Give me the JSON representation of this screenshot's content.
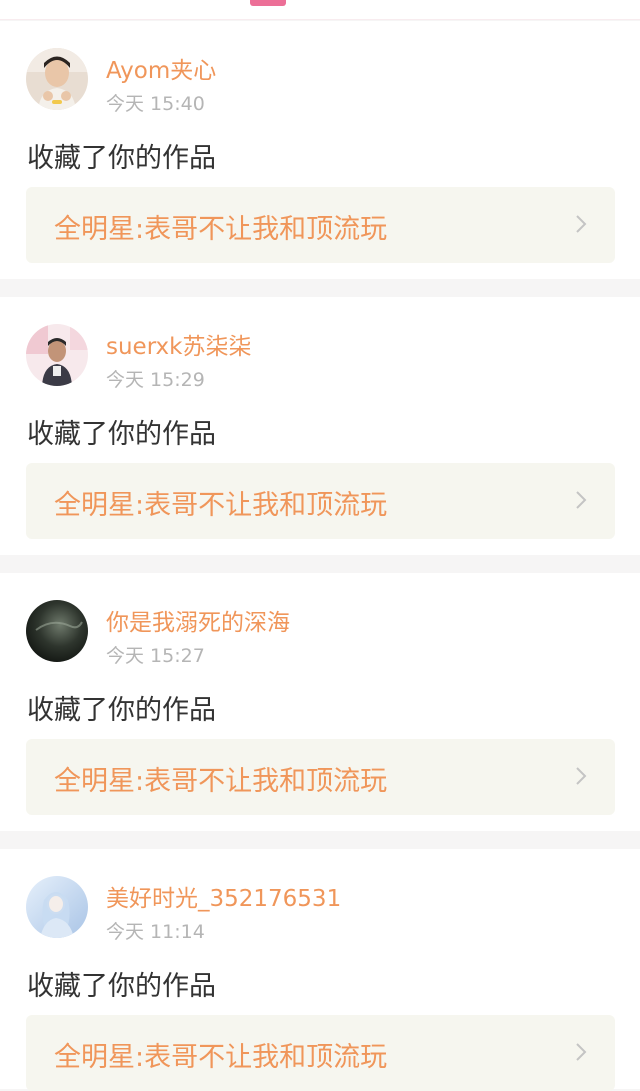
{
  "notifications": [
    {
      "username": "Ayom夹心",
      "time": "今天 15:40",
      "action": "收藏了你的作品",
      "work_title": "全明星:表哥不让我和顶流玩",
      "avatar_icon": "user-avatar-photo"
    },
    {
      "username": "suerxk苏柒柒",
      "time": "今天 15:29",
      "action": "收藏了你的作品",
      "work_title": "全明星:表哥不让我和顶流玩",
      "avatar_icon": "user-avatar-photo"
    },
    {
      "username": "你是我溺死的深海",
      "time": "今天 15:27",
      "action": "收藏了你的作品",
      "work_title": "全明星:表哥不让我和顶流玩",
      "avatar_icon": "user-avatar-photo"
    },
    {
      "username": "美好时光_352176531",
      "time": "今天 11:14",
      "action": "收藏了你的作品",
      "work_title": "全明星:表哥不让我和顶流玩",
      "avatar_icon": "user-avatar-photo"
    }
  ],
  "colors": {
    "accent": "#ec6f97",
    "username": "#f0965a",
    "time": "#b5b5b5",
    "action_text": "#333333",
    "link_bg": "#f6f6ef"
  },
  "icons": {
    "chevron": "chevron-right-icon"
  }
}
